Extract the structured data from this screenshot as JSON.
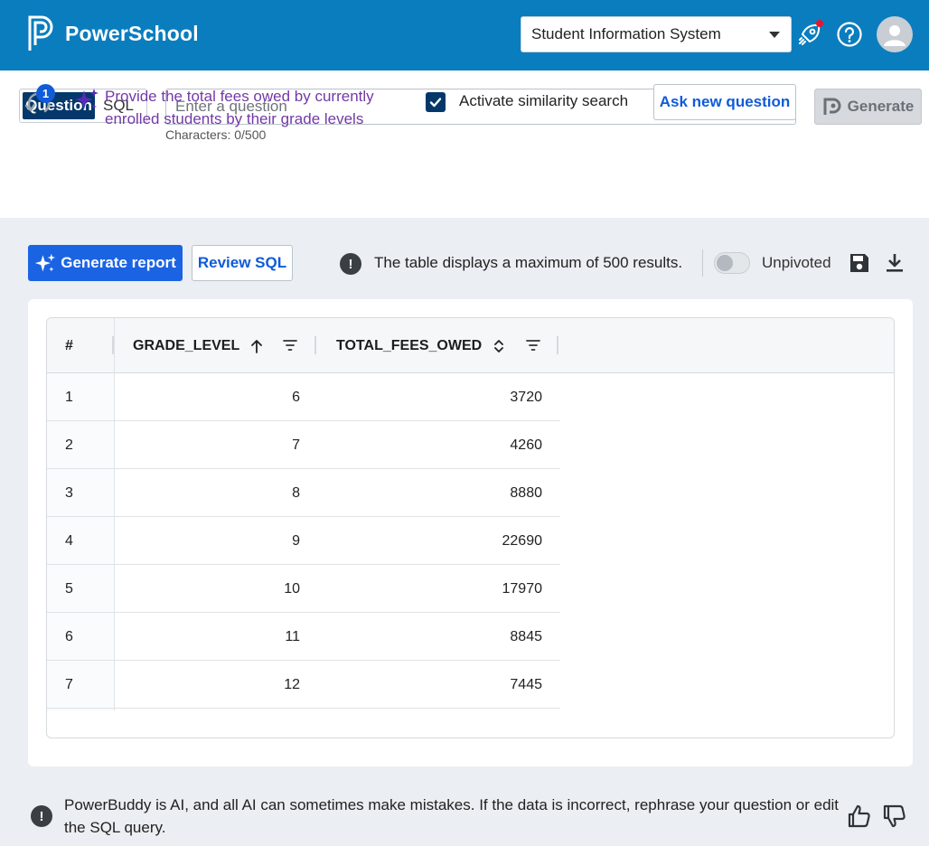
{
  "header": {
    "brand": "PowerSchool",
    "app_selector": {
      "selected": "Student Information System"
    }
  },
  "query": {
    "modes": {
      "question": "Question",
      "sql": "SQL",
      "active": "question"
    },
    "input_placeholder": "Enter a question",
    "input_value": "",
    "char_count": "Characters: 0/500",
    "generate_label": "Generate",
    "history_count": "1",
    "previous_question": "Provide the total fees owed by currently enrolled students by their grade levels",
    "similarity_search": {
      "label": "Activate similarity search",
      "checked": true
    },
    "ask_new_label": "Ask new question"
  },
  "toolbar": {
    "generate_report_label": "Generate report",
    "review_sql_label": "Review SQL",
    "max_results_msg": "The table displays a maximum of 500 results.",
    "unpivoted_label": "Unpivoted",
    "unpivoted_on": false
  },
  "table": {
    "columns": [
      {
        "label": "#"
      },
      {
        "label": "GRADE_LEVEL",
        "sort": "asc"
      },
      {
        "label": "TOTAL_FEES_OWED",
        "sort": "none"
      }
    ],
    "rows": [
      {
        "index": "1",
        "grade_level": "6",
        "total_fees_owed": "3720"
      },
      {
        "index": "2",
        "grade_level": "7",
        "total_fees_owed": "4260"
      },
      {
        "index": "3",
        "grade_level": "8",
        "total_fees_owed": "8880"
      },
      {
        "index": "4",
        "grade_level": "9",
        "total_fees_owed": "22690"
      },
      {
        "index": "5",
        "grade_level": "10",
        "total_fees_owed": "17970"
      },
      {
        "index": "6",
        "grade_level": "11",
        "total_fees_owed": "8845"
      },
      {
        "index": "7",
        "grade_level": "12",
        "total_fees_owed": "7445"
      }
    ]
  },
  "footer": {
    "disclaimer": "PowerBuddy is AI, and all AI can sometimes make mistakes. If the data is incorrect, rephrase your question or edit the SQL query."
  },
  "colors": {
    "header_bg": "#0a7dbe",
    "primary": "#1a63e3",
    "dark_navy": "#04386b",
    "prompt_purple": "#7339a8",
    "notification_red": "#e3162c"
  }
}
